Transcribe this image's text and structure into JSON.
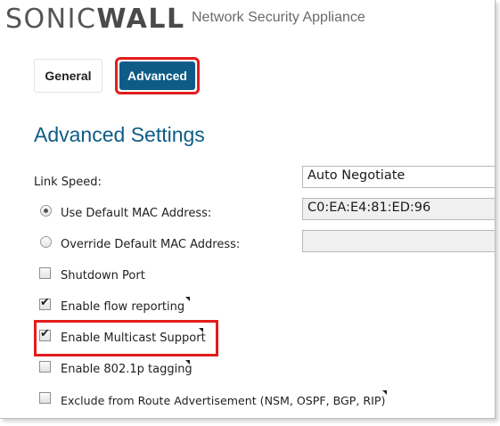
{
  "header": {
    "brand_light": "SONIC",
    "brand_bold": "WALL",
    "product": "Network Security Appliance"
  },
  "tabs": [
    {
      "label": "General",
      "active": false
    },
    {
      "label": "Advanced",
      "active": true
    }
  ],
  "section_title": "Advanced Settings",
  "link_speed": {
    "label": "Link Speed:",
    "value": "Auto Negotiate"
  },
  "mac": {
    "use_default_label": "Use Default MAC Address:",
    "use_default_value": "C0:EA:E4:81:ED:96",
    "use_default_selected": true,
    "override_label": "Override Default MAC Address:",
    "override_value": ""
  },
  "options": {
    "shutdown_port": {
      "label": "Shutdown Port",
      "checked": false
    },
    "flow_reporting": {
      "label": "Enable flow reporting",
      "checked": true
    },
    "multicast": {
      "label": "Enable Multicast Support",
      "checked": true
    },
    "tagging": {
      "label": "Enable 802.1p tagging",
      "checked": false
    },
    "exclude_route": {
      "label": "Exclude from Route Advertisement (NSM, OSPF, BGP, RIP)",
      "checked": false
    }
  },
  "colors": {
    "accent": "#0e5c86",
    "highlight": "#e41c1c"
  },
  "icons": {
    "tooltip": "tooltip-marker-icon",
    "check": "checkmark-icon"
  }
}
